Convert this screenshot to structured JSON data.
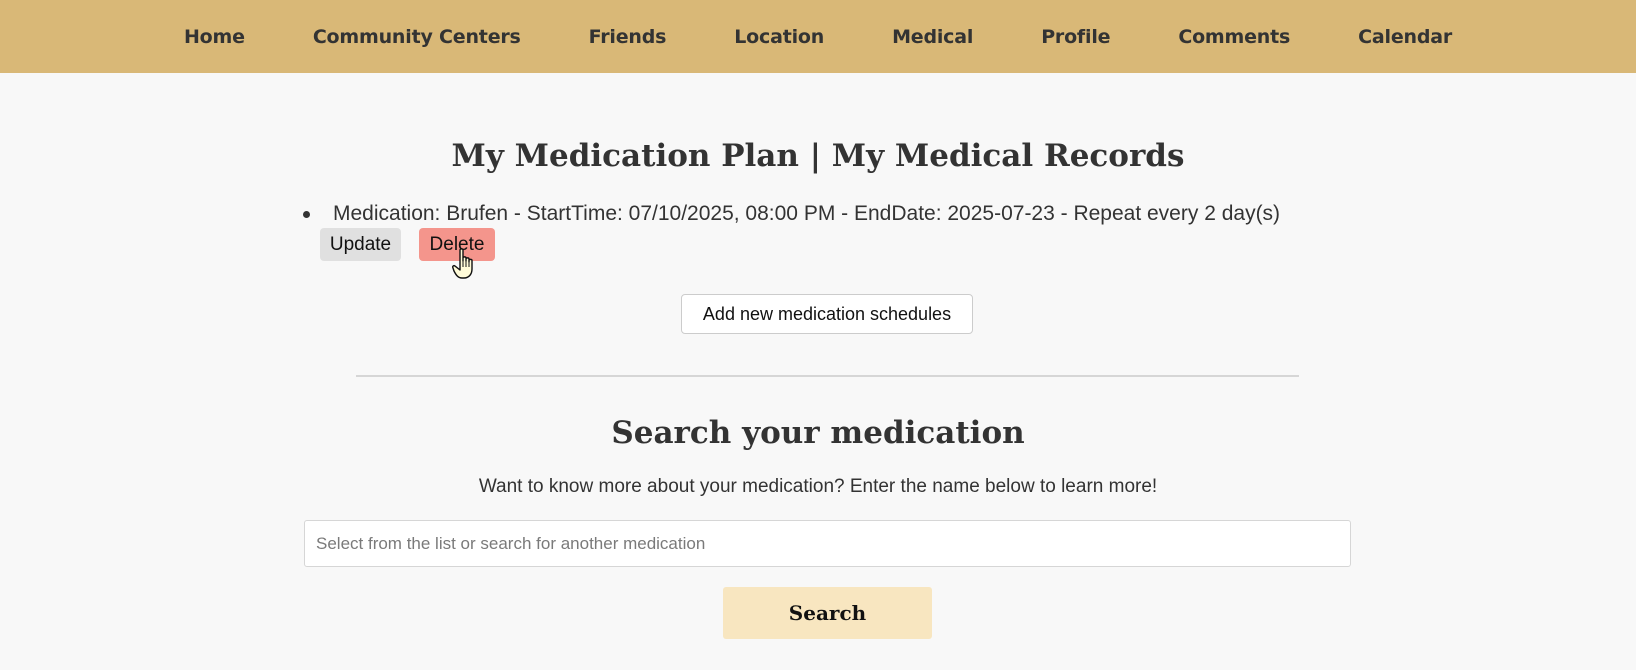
{
  "nav": {
    "items": [
      {
        "label": "Home"
      },
      {
        "label": "Community Centers"
      },
      {
        "label": "Friends"
      },
      {
        "label": "Location"
      },
      {
        "label": "Medical"
      },
      {
        "label": "Profile"
      },
      {
        "label": "Comments"
      },
      {
        "label": "Calendar"
      }
    ]
  },
  "medication_plan": {
    "title": "My Medication Plan | My Medical Records",
    "items": [
      {
        "text": "Medication: Brufen - StartTime: 07/10/2025, 08:00 PM - EndDate: 2025-07-23 - Repeat every 2 day(s)",
        "update_label": "Update",
        "delete_label": "Delete"
      }
    ],
    "add_button_label": "Add new medication schedules"
  },
  "search": {
    "title": "Search your medication",
    "subtitle": "Want to know more about your medication? Enter the name below to learn more!",
    "placeholder": "Select from the list or search for another medication",
    "value": "",
    "button_label": "Search"
  },
  "colors": {
    "navbar": "#d9b877",
    "delete_button": "#f4958c",
    "update_button": "#e0e0e0",
    "search_button": "#f8e6c0"
  },
  "icons": {
    "cursor": "hand-pointer-icon"
  }
}
